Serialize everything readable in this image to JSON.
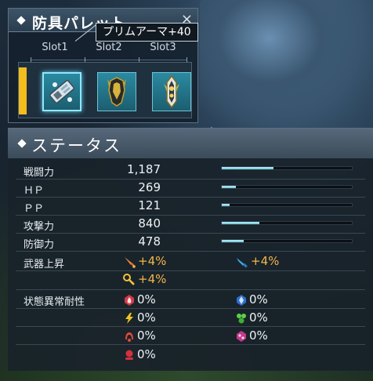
{
  "palette": {
    "title": "防具パレット",
    "close": "×",
    "slots": [
      {
        "label": "Slot1",
        "selected": true,
        "icon": "armor-unit-icon"
      },
      {
        "label": "Slot2",
        "selected": false,
        "icon": "armor-unit-icon"
      },
      {
        "label": "Slot3",
        "selected": false,
        "icon": "armor-unit-icon"
      }
    ],
    "tooltip": "プリムアーマ+40",
    "accent_color": "#f2bd1d"
  },
  "status": {
    "title": "ステータス",
    "stats": [
      {
        "label": "戦闘力",
        "value": "1,187",
        "bar": 0.4
      },
      {
        "label": "ＨＰ",
        "value": "269",
        "bar": 0.11
      },
      {
        "label": "ＰＰ",
        "value": "121",
        "bar": 0.06
      },
      {
        "label": "攻撃力",
        "value": "840",
        "bar": 0.29
      },
      {
        "label": "防御力",
        "value": "478",
        "bar": 0.17
      }
    ],
    "weapon_up": {
      "label": "武器上昇",
      "melee": "+4%",
      "ranged": "+4%",
      "technique": "+4%",
      "color": "#f4b64a"
    },
    "resist": {
      "label": "状態異常耐性",
      "values": [
        "0%",
        "0%",
        "0%",
        "0%",
        "0%",
        "0%",
        "0%"
      ]
    }
  }
}
